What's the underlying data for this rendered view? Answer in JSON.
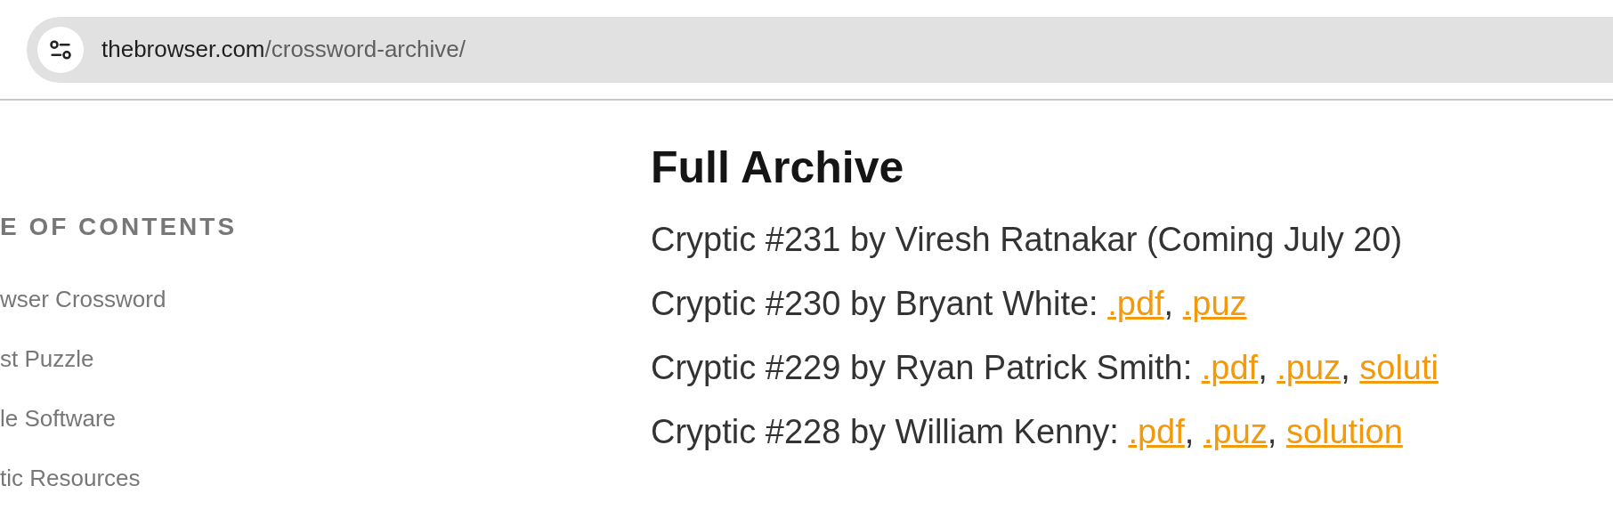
{
  "address_bar": {
    "host": "thebrowser.com",
    "path": "/crossword-archive/"
  },
  "sidebar": {
    "heading": "E OF CONTENTS",
    "items": [
      "wser Crossword",
      "st Puzzle",
      "le Software",
      "tic Resources"
    ]
  },
  "main": {
    "heading": "Full Archive",
    "entries": [
      {
        "parts": [
          {
            "kind": "text",
            "text": "Cryptic #231 by Viresh Ratnakar (Coming July 20)"
          }
        ]
      },
      {
        "parts": [
          {
            "kind": "text",
            "text": "Cryptic #230 by Bryant White: "
          },
          {
            "kind": "link",
            "text": ".pdf"
          },
          {
            "kind": "text",
            "text": ", "
          },
          {
            "kind": "link",
            "text": ".puz"
          }
        ]
      },
      {
        "parts": [
          {
            "kind": "text",
            "text": "Cryptic #229 by Ryan Patrick Smith: "
          },
          {
            "kind": "link",
            "text": ".pdf"
          },
          {
            "kind": "text",
            "text": ", "
          },
          {
            "kind": "link",
            "text": ".puz"
          },
          {
            "kind": "text",
            "text": ", "
          },
          {
            "kind": "link",
            "text": "soluti"
          }
        ]
      },
      {
        "parts": [
          {
            "kind": "text",
            "text": "Cryptic #228 by William Kenny: "
          },
          {
            "kind": "link",
            "text": ".pdf"
          },
          {
            "kind": "text",
            "text": ", "
          },
          {
            "kind": "link",
            "text": ".puz"
          },
          {
            "kind": "text",
            "text": ", "
          },
          {
            "kind": "link",
            "text": "solution"
          }
        ]
      }
    ]
  }
}
